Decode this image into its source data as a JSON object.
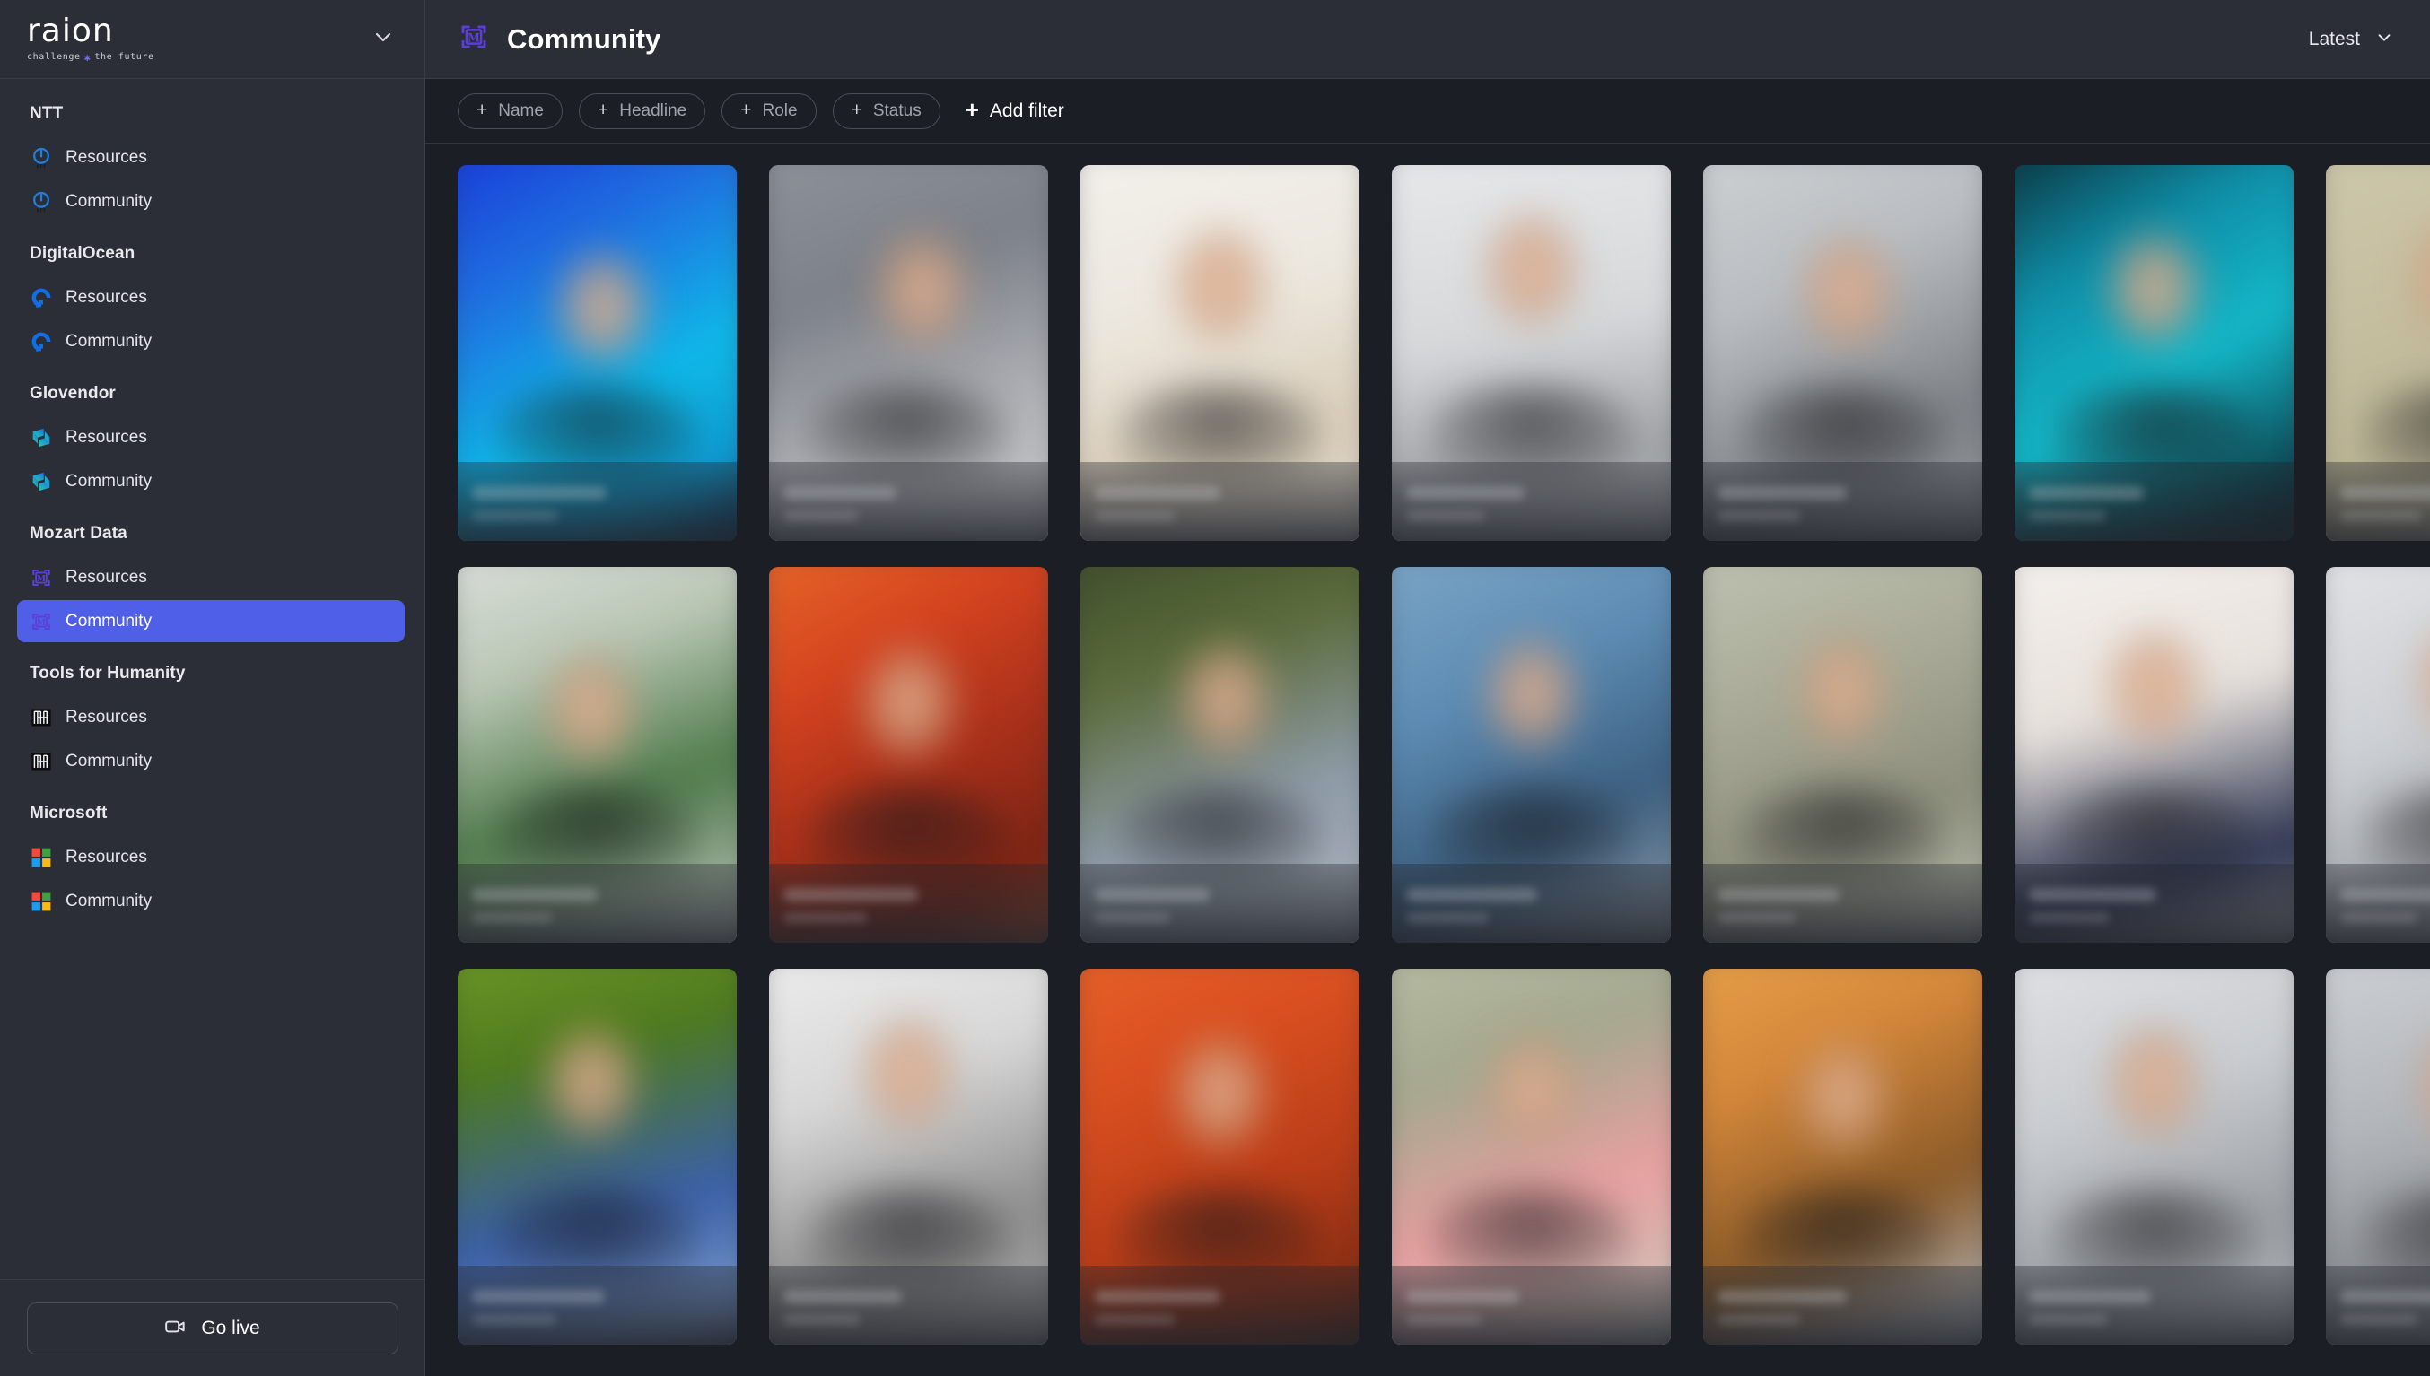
{
  "sidebar": {
    "brand": {
      "name": "raion",
      "tagline_before": "challenge",
      "tagline_star": "✱",
      "tagline_after": "the future",
      "collapse_icon": "chevron-down-icon"
    },
    "groups": [
      {
        "title": "NTT",
        "logo": "ntt-logo",
        "items": [
          {
            "label": "Resources",
            "active": false
          },
          {
            "label": "Community",
            "active": false
          }
        ]
      },
      {
        "title": "DigitalOcean",
        "logo": "digitalocean-logo",
        "items": [
          {
            "label": "Resources",
            "active": false
          },
          {
            "label": "Community",
            "active": false
          }
        ]
      },
      {
        "title": "Glovendor",
        "logo": "glovendor-logo",
        "items": [
          {
            "label": "Resources",
            "active": false
          },
          {
            "label": "Community",
            "active": false
          }
        ]
      },
      {
        "title": "Mozart Data",
        "logo": "mozartdata-logo",
        "items": [
          {
            "label": "Resources",
            "active": false
          },
          {
            "label": "Community",
            "active": true
          }
        ]
      },
      {
        "title": "Tools for Humanity",
        "logo": "toolsforhumanity-logo",
        "items": [
          {
            "label": "Resources",
            "active": false
          },
          {
            "label": "Community",
            "active": false
          }
        ]
      },
      {
        "title": "Microsoft",
        "logo": "microsoft-logo",
        "items": [
          {
            "label": "Resources",
            "active": false
          },
          {
            "label": "Community",
            "active": false
          }
        ]
      }
    ],
    "footer": {
      "go_live_label": "Go live",
      "go_live_icon": "video-camera-icon"
    }
  },
  "header": {
    "icon": "mozartdata-logo",
    "title": "Community",
    "sort": {
      "label": "Latest",
      "icon": "chevron-down-icon"
    }
  },
  "filters": {
    "chips": [
      {
        "label": "Name",
        "icon": "plus-icon"
      },
      {
        "label": "Headline",
        "icon": "plus-icon"
      },
      {
        "label": "Role",
        "icon": "plus-icon"
      },
      {
        "label": "Status",
        "icon": "plus-icon"
      }
    ],
    "add_filter": {
      "label": "Add filter",
      "icon": "plus-icon"
    }
  },
  "colors": {
    "accent": "#4f5fe8",
    "sidebar_bg": "#2b2e36",
    "content_bg": "#1b1e25",
    "border": "#3a3d45"
  },
  "grid": {
    "columns": 8,
    "cards": [
      {
        "bg": "linear-gradient(150deg,#1836d8 0%,#1f6fe0 30%,#0fb9e8 60%,#0e9ad0 80%,#0c1a3a 100%)",
        "skin": "52% 38%",
        "name_w": 150,
        "sub_w": 96
      },
      {
        "bg": "linear-gradient(160deg,#8f939a 0%,#7d8189 35%,#b5b7bb 70%,#cfd1d4 100%)",
        "skin": "55% 33%",
        "name_w": 126,
        "sub_w": 84
      },
      {
        "bg": "linear-gradient(165deg,#f4f2ee 0%,#ece7de 40%,#d9cdb8 70%,#e8e4dd 100%)",
        "skin": "50% 32%",
        "name_w": 140,
        "sub_w": 90
      },
      {
        "bg": "linear-gradient(170deg,#e9eaec 0%,#d6d8da 45%,#9fa2a6 75%,#c9cbcd 100%)",
        "skin": "50% 28%",
        "name_w": 132,
        "sub_w": 88
      },
      {
        "bg": "linear-gradient(155deg,#cfd3d6 0%,#b9bdc1 35%,#7d8186 70%,#a8acb0 100%)",
        "skin": "52% 34%",
        "name_w": 144,
        "sub_w": 92
      },
      {
        "bg": "linear-gradient(150deg,#0a2a33 0%,#0f8fa8 30%,#14b8c9 55%,#0d3b46 85%,#0a1a20 100%)",
        "skin": "50% 33%",
        "name_w": 128,
        "sub_w": 86
      },
      {
        "bg": "linear-gradient(160deg,#cfc9ab 0%,#c4bd9e 40%,#b9b392 70%,#d6d1b9 100%)",
        "skin": "48% 30%",
        "name_w": 138,
        "sub_w": 90
      },
      {
        "bg": "linear-gradient(165deg,#d8d4c4 0%,#c8c3ae 45%,#2a3f7a 78%,#8d9099 100%)",
        "skin": "50% 30%",
        "name_w": 134,
        "sub_w": 88
      },
      {
        "bg": "linear-gradient(160deg,#dfe2e0 0%,#b9c6b4 30%,#4e7a4a 60%,#cfd2cf 95%)",
        "skin": "48% 38%",
        "name_w": 140,
        "sub_w": 90
      },
      {
        "bg": "linear-gradient(150deg,#e86a2a 0%,#d4431f 30%,#a8301a 55%,#7a2414 80%,#c85a28 100%)",
        "skin": "50% 36%",
        "name_w": 150,
        "sub_w": 94
      },
      {
        "bg": "linear-gradient(160deg,#3b4a2a 0%,#5a6b3a 30%,#8f9ba8 62%,#b6bcc4 95%)",
        "skin": "52% 35%",
        "name_w": 128,
        "sub_w": 84
      },
      {
        "bg": "linear-gradient(155deg,#7fa8c8 0%,#5d8cb4 35%,#3c5f80 65%,#9aa6b0 95%)",
        "skin": "50% 34%",
        "name_w": 146,
        "sub_w": 92
      },
      {
        "bg": "linear-gradient(160deg,#c2c4b4 0%,#a9ab98 35%,#8d8f7c 65%,#c8cabb 95%)",
        "skin": "50% 33%",
        "name_w": 136,
        "sub_w": 88
      },
      {
        "bg": "linear-gradient(165deg,#f6f2ef 0%,#e7e1dc 40%,#2c3350 75%,#d4d2d0 100%)",
        "skin": "50% 32%",
        "name_w": 142,
        "sub_w": 90
      },
      {
        "bg": "linear-gradient(155deg,#e4e6e8 0%,#cdd0d4 40%,#9fa3a8 72%,#c6c9cc 100%)",
        "skin": "50% 30%",
        "name_w": 130,
        "sub_w": 86
      },
      {
        "bg": "linear-gradient(160deg,#d0d3d6 0%,#b4b8bc 40%,#878b90 72%,#bfc2c6 100%)",
        "skin": "50% 31%",
        "name_w": 134,
        "sub_w": 88
      },
      {
        "bg": "linear-gradient(165deg,#6f9a28 0%,#4e7a1e 28%,#3a5fa8 62%,#7f9fd0 88%,#515a60 100%)",
        "skin": "48% 30%",
        "name_w": 148,
        "sub_w": 94
      },
      {
        "bg": "linear-gradient(160deg,#efefef 0%,#d7d7d7 35%,#8e8e8e 68%,#b8b8b8 100%)",
        "skin": "50% 28%",
        "name_w": 132,
        "sub_w": 86
      },
      {
        "bg": "linear-gradient(155deg,#e8622a 0%,#d94f20 30%,#b83c18 60%,#7c2a12 88%,#3a1a0c 100%)",
        "skin": "50% 33%",
        "name_w": 140,
        "sub_w": 90
      },
      {
        "bg": "linear-gradient(160deg,#b9bda4 0%,#a4a88f 30%,#e8a0a0 60%,#cfd2c6 95%)",
        "skin": "50% 32%",
        "name_w": 126,
        "sub_w": 84
      },
      {
        "bg": "linear-gradient(155deg,#e8a24a 0%,#d4873a 30%,#8a5a28 62%,#b4b8bc 90%)",
        "skin": "50% 34%",
        "name_w": 144,
        "sub_w": 92
      },
      {
        "bg": "linear-gradient(160deg,#e2e4e6 0%,#c9ccd0 38%,#9a9ea3 70%,#c2c5c9 100%)",
        "skin": "50% 30%",
        "name_w": 136,
        "sub_w": 88
      },
      {
        "bg": "linear-gradient(165deg,#cfd2d6 0%,#b2b6bb 40%,#86898e 72%,#b9bcc0 100%)",
        "skin": "50% 31%",
        "name_w": 130,
        "sub_w": 86
      },
      {
        "bg": "linear-gradient(160deg,#d4d7da 0%,#bcc0c4 40%,#90949a 72%,#c0c3c7 100%)",
        "skin": "50% 30%",
        "name_w": 138,
        "sub_w": 90
      }
    ]
  }
}
